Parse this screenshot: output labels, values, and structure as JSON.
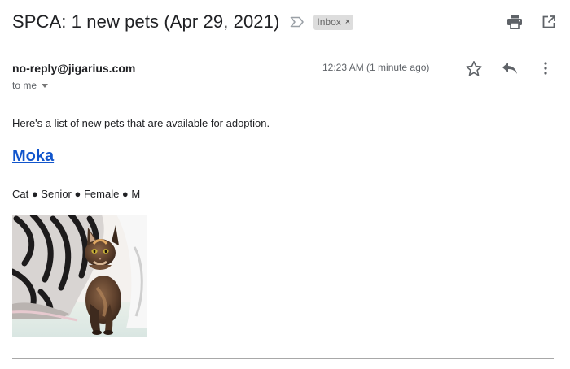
{
  "email": {
    "subject": "SPCA: 1 new pets (Apr 29, 2021)",
    "label": "Inbox",
    "label_remove": "×",
    "sender": "no-reply@jigarius.com",
    "recipient": "to me",
    "timestamp": "12:23 AM (1 minute ago)"
  },
  "body": {
    "intro": "Here's a list of new pets that are available for adoption.",
    "pet": {
      "name": "Moka",
      "meta": "Cat ● Senior ● Female ● M"
    }
  },
  "icons": {
    "importance": "importance-marker-icon",
    "print": "print-icon",
    "open_new_window": "open-in-new-window-icon",
    "star": "star-icon",
    "reply": "reply-icon",
    "more": "more-vert-icon"
  },
  "colors": {
    "link": "#1155cc",
    "chip_bg": "#dddddd",
    "muted_text": "#5f6368",
    "icon": "#5f6368"
  }
}
